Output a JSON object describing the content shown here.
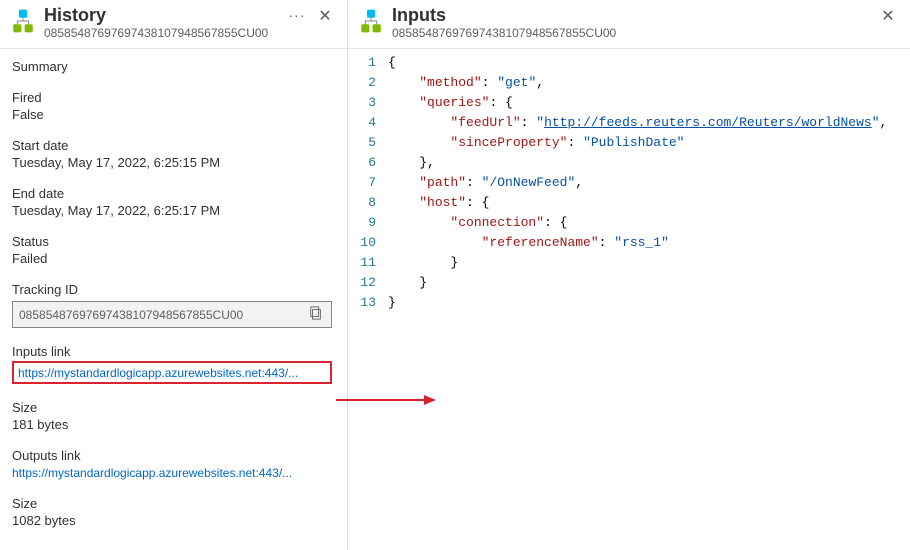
{
  "historyPanel": {
    "title": "History",
    "subtitle": "08585487697697438107948567855CU00",
    "summaryLabel": "Summary",
    "firedLabel": "Fired",
    "firedValue": "False",
    "startDateLabel": "Start date",
    "startDateValue": "Tuesday, May 17, 2022, 6:25:15 PM",
    "endDateLabel": "End date",
    "endDateValue": "Tuesday, May 17, 2022, 6:25:17 PM",
    "statusLabel": "Status",
    "statusValue": "Failed",
    "trackingIdLabel": "Tracking ID",
    "trackingIdValue": "08585487697697438107948567855CU00",
    "inputsLinkLabel": "Inputs link",
    "inputsLinkValue": "https://mystandardlogicapp.azurewebsites.net:443/...",
    "inputsSizeLabel": "Size",
    "inputsSizeValue": "181 bytes",
    "outputsLinkLabel": "Outputs link",
    "outputsLinkValue": "https://mystandardlogicapp.azurewebsites.net:443/...",
    "outputsSizeLabel": "Size",
    "outputsSizeValue": "1082 bytes"
  },
  "inputsPanel": {
    "title": "Inputs",
    "subtitle": "08585487697697438107948567855CU00"
  },
  "code": {
    "method": "get",
    "queries": {
      "feedUrl": "http://feeds.reuters.com/Reuters/worldNews",
      "sinceProperty": "PublishDate"
    },
    "path": "/OnNewFeed",
    "host": {
      "connection": {
        "referenceName": "rss_1"
      }
    }
  }
}
